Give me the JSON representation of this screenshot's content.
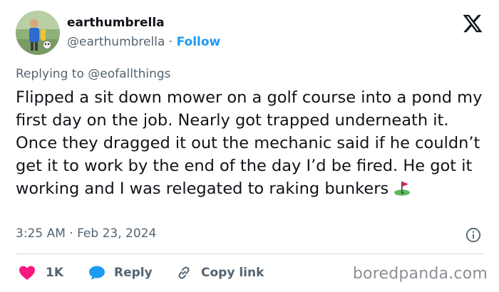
{
  "author": {
    "display_name": "earthumbrella",
    "handle": "@earthumbrella",
    "separator": " · ",
    "follow_label": "Follow"
  },
  "tweet": {
    "replying_to": "Replying to @eofallthings",
    "text": "Flipped a sit down mower on a golf course into a pond my first day on the job. Nearly got trapped underneath it. Once they dragged it out the mechanic said if he couldn’t get it to work by the end of the day I’d be fired. He got it working and I was relegated to raking bunkers",
    "timestamp": "3:25 AM · Feb 23, 2024"
  },
  "actions": {
    "like_count": "1K",
    "reply_label": "Reply",
    "copy_link_label": "Copy link"
  },
  "icons": {
    "brand": "x-logo-icon",
    "like": "heart-icon",
    "reply": "speech-bubble-icon",
    "copy": "link-icon",
    "info": "info-icon",
    "emoji": "golf-flag-icon"
  },
  "colors": {
    "text": "#0f1419",
    "secondary": "#536471",
    "accent": "#1d9bf0",
    "like": "#f91880",
    "divider": "#cfd9de"
  },
  "watermark": "boredpanda.com"
}
